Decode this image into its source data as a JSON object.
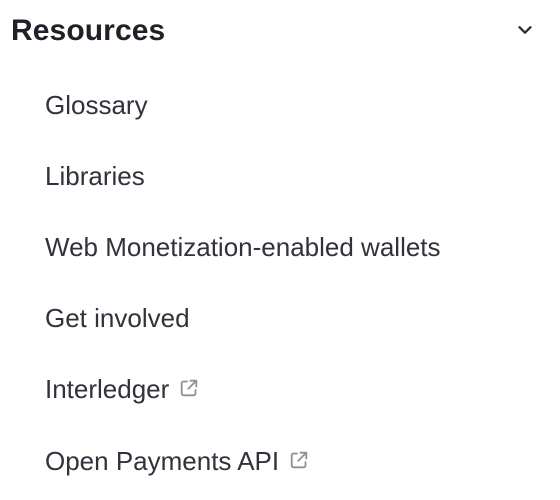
{
  "section": {
    "title": "Resources",
    "toggle_icon": "chevron-down-icon"
  },
  "items": [
    {
      "label": "Glossary",
      "external": false
    },
    {
      "label": "Libraries",
      "external": false
    },
    {
      "label": "Web Monetization-enabled wallets",
      "external": false
    },
    {
      "label": "Get involved",
      "external": false
    },
    {
      "label": "Interledger",
      "external": true,
      "icon": "external-link-icon"
    },
    {
      "label": "Open Payments API",
      "external": true,
      "icon": "external-link-icon"
    }
  ],
  "colors": {
    "text": "#30333b",
    "title": "#1f2128",
    "icon": "#8d9099",
    "background": "#ffffff"
  }
}
